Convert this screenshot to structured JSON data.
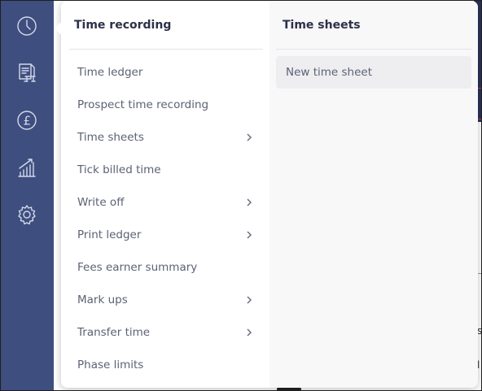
{
  "rail": {
    "icons": [
      "clock-icon",
      "report-icon",
      "pound-icon",
      "bar-chart-icon",
      "gear-icon"
    ],
    "pound_glyph": "£"
  },
  "menu": {
    "title": "Time recording",
    "items": [
      {
        "label": "Time ledger",
        "has_submenu": false
      },
      {
        "label": "Prospect time recording",
        "has_submenu": false
      },
      {
        "label": "Time sheets",
        "has_submenu": true
      },
      {
        "label": "Tick billed time",
        "has_submenu": false
      },
      {
        "label": "Write off",
        "has_submenu": true
      },
      {
        "label": "Print ledger",
        "has_submenu": true
      },
      {
        "label": "Fees earner summary",
        "has_submenu": false
      },
      {
        "label": "Mark ups",
        "has_submenu": true
      },
      {
        "label": "Transfer time",
        "has_submenu": true
      },
      {
        "label": "Phase limits",
        "has_submenu": false
      }
    ]
  },
  "submenu": {
    "title": "Time sheets",
    "items": [
      {
        "label": "New time sheet"
      }
    ]
  },
  "background": {
    "glyph_a": "s",
    "glyph_b": "l"
  },
  "colors": {
    "rail": "#3e4e7f",
    "panel": "#ffffff",
    "submenu_bg": "#f8f8f9",
    "highlight": "#eeeef1",
    "text": "#5c6275",
    "title": "#2c3147"
  }
}
